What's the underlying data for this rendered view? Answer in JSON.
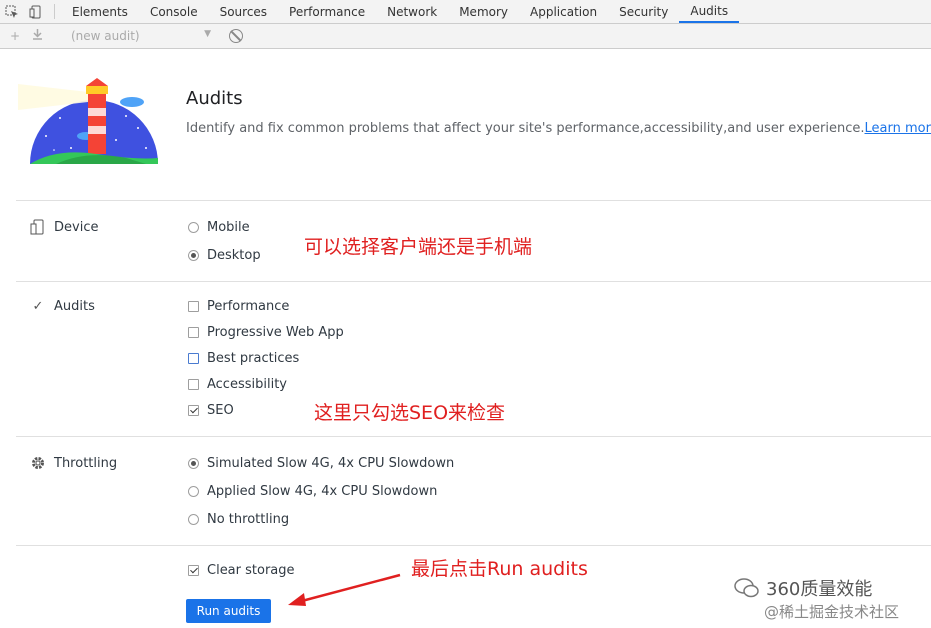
{
  "devtools": {
    "tabs": [
      "Elements",
      "Console",
      "Sources",
      "Performance",
      "Network",
      "Memory",
      "Application",
      "Security",
      "Audits"
    ],
    "active_tab": "Audits"
  },
  "toolbar": {
    "audit_select": "(new audit)"
  },
  "header": {
    "title": "Audits",
    "description": "Identify and fix common problems that affect your site's performance,accessibility,and user experience.",
    "learn_more": "Learn more"
  },
  "device": {
    "label": "Device",
    "options": [
      {
        "label": "Mobile",
        "selected": false
      },
      {
        "label": "Desktop",
        "selected": true
      }
    ]
  },
  "audits": {
    "label": "Audits",
    "options": [
      {
        "label": "Performance",
        "checked": false
      },
      {
        "label": "Progressive Web App",
        "checked": false
      },
      {
        "label": "Best practices",
        "checked": false
      },
      {
        "label": "Accessibility",
        "checked": false
      },
      {
        "label": "SEO",
        "checked": true
      }
    ]
  },
  "throttling": {
    "label": "Throttling",
    "options": [
      {
        "label": "Simulated Slow 4G, 4x CPU Slowdown",
        "selected": true
      },
      {
        "label": "Applied Slow 4G, 4x CPU Slowdown",
        "selected": false
      },
      {
        "label": "No throttling",
        "selected": false
      }
    ]
  },
  "clear_storage": {
    "label": "Clear storage",
    "checked": true
  },
  "run_button": "Run audits",
  "annotations": {
    "device_note": "可以选择客户端还是手机端",
    "seo_note": "这里只勾选SEO来检查",
    "run_note": "最后点击Run audits"
  },
  "watermark": {
    "line1": "360质量效能",
    "line2": "@稀土掘金技术社区"
  },
  "colors": {
    "accent": "#1a73e8",
    "annotation": "#e02020"
  }
}
